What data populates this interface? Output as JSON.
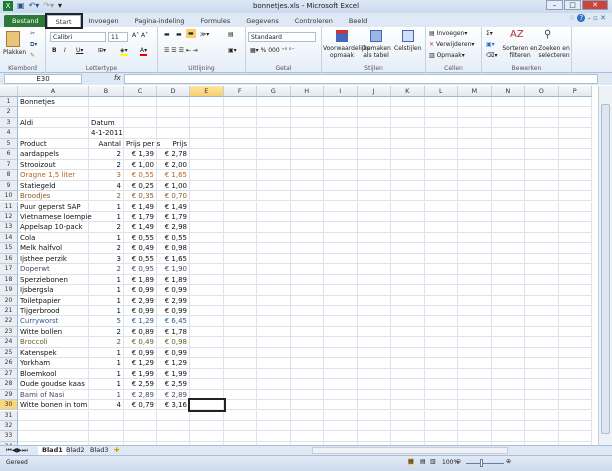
{
  "window": {
    "title": "bonnetjes.xls - Microsoft Excel"
  },
  "tabs": [
    "Bestand",
    "Start",
    "Invoegen",
    "Pagina-indeling",
    "Formules",
    "Gegevens",
    "Controleren",
    "Beeld"
  ],
  "ribbon": {
    "clipboard": {
      "paste": "Plakken",
      "label": "Klembord"
    },
    "font": {
      "name": "Calibri",
      "size": "11",
      "label": "Lettertype"
    },
    "alignment": {
      "label": "Uitlijning"
    },
    "number": {
      "format": "Standaard",
      "label": "Getal"
    },
    "styles": {
      "conditional": "Voorwaardelijke opmaak",
      "table": "Opmaken als tabel",
      "cell": "Celstijlen",
      "label": "Stijlen"
    },
    "cells": {
      "insert": "Invoegen",
      "delete": "Verwijderen",
      "format": "Opmaak",
      "label": "Cellen"
    },
    "editing": {
      "sort": "Sorteren en filteren",
      "find": "Zoeken en selecteren",
      "label": "Bewerken"
    }
  },
  "formula_bar": {
    "name_box": "E30",
    "fx": "fx",
    "value": ""
  },
  "columns": [
    "A",
    "B",
    "C",
    "D",
    "E",
    "F",
    "G",
    "H",
    "I",
    "J",
    "K",
    "L",
    "M",
    "N",
    "O",
    "P"
  ],
  "selected_cell": "E30",
  "rows": [
    [
      "Bonnetjes",
      "",
      "",
      ""
    ],
    [
      "",
      "",
      "",
      ""
    ],
    [
      "Aldi",
      "Datum",
      "",
      ""
    ],
    [
      "",
      "4-1-2011",
      "",
      ""
    ],
    [
      "Product",
      "Aantal",
      "Prijs per s",
      "Prijs"
    ],
    [
      "aardappels",
      "2",
      "€ 1,39",
      "€ 2,78"
    ],
    [
      "Strooizout",
      "2",
      "€ 1,00",
      "€ 2,00"
    ],
    [
      "Oragne 1,5 liter",
      "3",
      "€ 0,55",
      "€ 1,65"
    ],
    [
      "Statiegeld",
      "4",
      "€ 0,25",
      "€ 1,00"
    ],
    [
      "Broodjes",
      "2",
      "€ 0,35",
      "€ 0,70"
    ],
    [
      "Puur geperst SAP",
      "1",
      "€ 1,49",
      "€ 1,49"
    ],
    [
      "Vietnamese loempie",
      "1",
      "€ 1,79",
      "€ 1,79"
    ],
    [
      "Appelsap 10-pack",
      "2",
      "€ 1,49",
      "€ 2,98"
    ],
    [
      "Cola",
      "1",
      "€ 0,55",
      "€ 0,55"
    ],
    [
      "Melk halfvol",
      "2",
      "€ 0,49",
      "€ 0,98"
    ],
    [
      "Ijsthee perzik",
      "3",
      "€ 0,55",
      "€ 1,65"
    ],
    [
      "Doperwt",
      "2",
      "€ 0,95",
      "€ 1,90"
    ],
    [
      "Sperziebonen",
      "1",
      "€ 1,89",
      "€ 1,89"
    ],
    [
      "Ijsbergsla",
      "1",
      "€ 0,99",
      "€ 0,99"
    ],
    [
      "Toiletpapier",
      "1",
      "€ 2,99",
      "€ 2,99"
    ],
    [
      "Tijgerbrood",
      "1",
      "€ 0,99",
      "€ 0,99"
    ],
    [
      "Curryworst",
      "5",
      "€ 1,29",
      "€ 6,45"
    ],
    [
      "Witte bollen",
      "2",
      "€ 0,89",
      "€ 1,78"
    ],
    [
      "Broccoli",
      "2",
      "€ 0,49",
      "€ 0,98"
    ],
    [
      "Katenspek",
      "1",
      "€ 0,99",
      "€ 0,99"
    ],
    [
      "Yorkham",
      "1",
      "€ 1,29",
      "€ 1,29"
    ],
    [
      "Bloemkool",
      "1",
      "€ 1,99",
      "€ 1,99"
    ],
    [
      "Oude goudse kaas",
      "1",
      "€ 2,59",
      "€ 2,59"
    ],
    [
      "Bami of Nasi",
      "1",
      "€ 2,89",
      "€ 2,89"
    ],
    [
      "Witte bonen in tom",
      "4",
      "€ 0,79",
      "€ 3,16"
    ],
    [
      "",
      "",
      "",
      ""
    ],
    [
      "",
      "",
      "",
      ""
    ],
    [
      "",
      "",
      "",
      ""
    ],
    [
      "",
      "",
      "",
      ""
    ]
  ],
  "row_colors": {
    "8": "#b8651b",
    "10": "#8a5a2a",
    "17": "#4a4a6a",
    "22": "#2a5a9a",
    "24": "#6a5a2a",
    "29": "#4a4a6a"
  },
  "sheets": [
    "Blad1",
    "Blad2",
    "Blad3"
  ],
  "status": {
    "mode": "Gereed",
    "zoom": "100%"
  }
}
